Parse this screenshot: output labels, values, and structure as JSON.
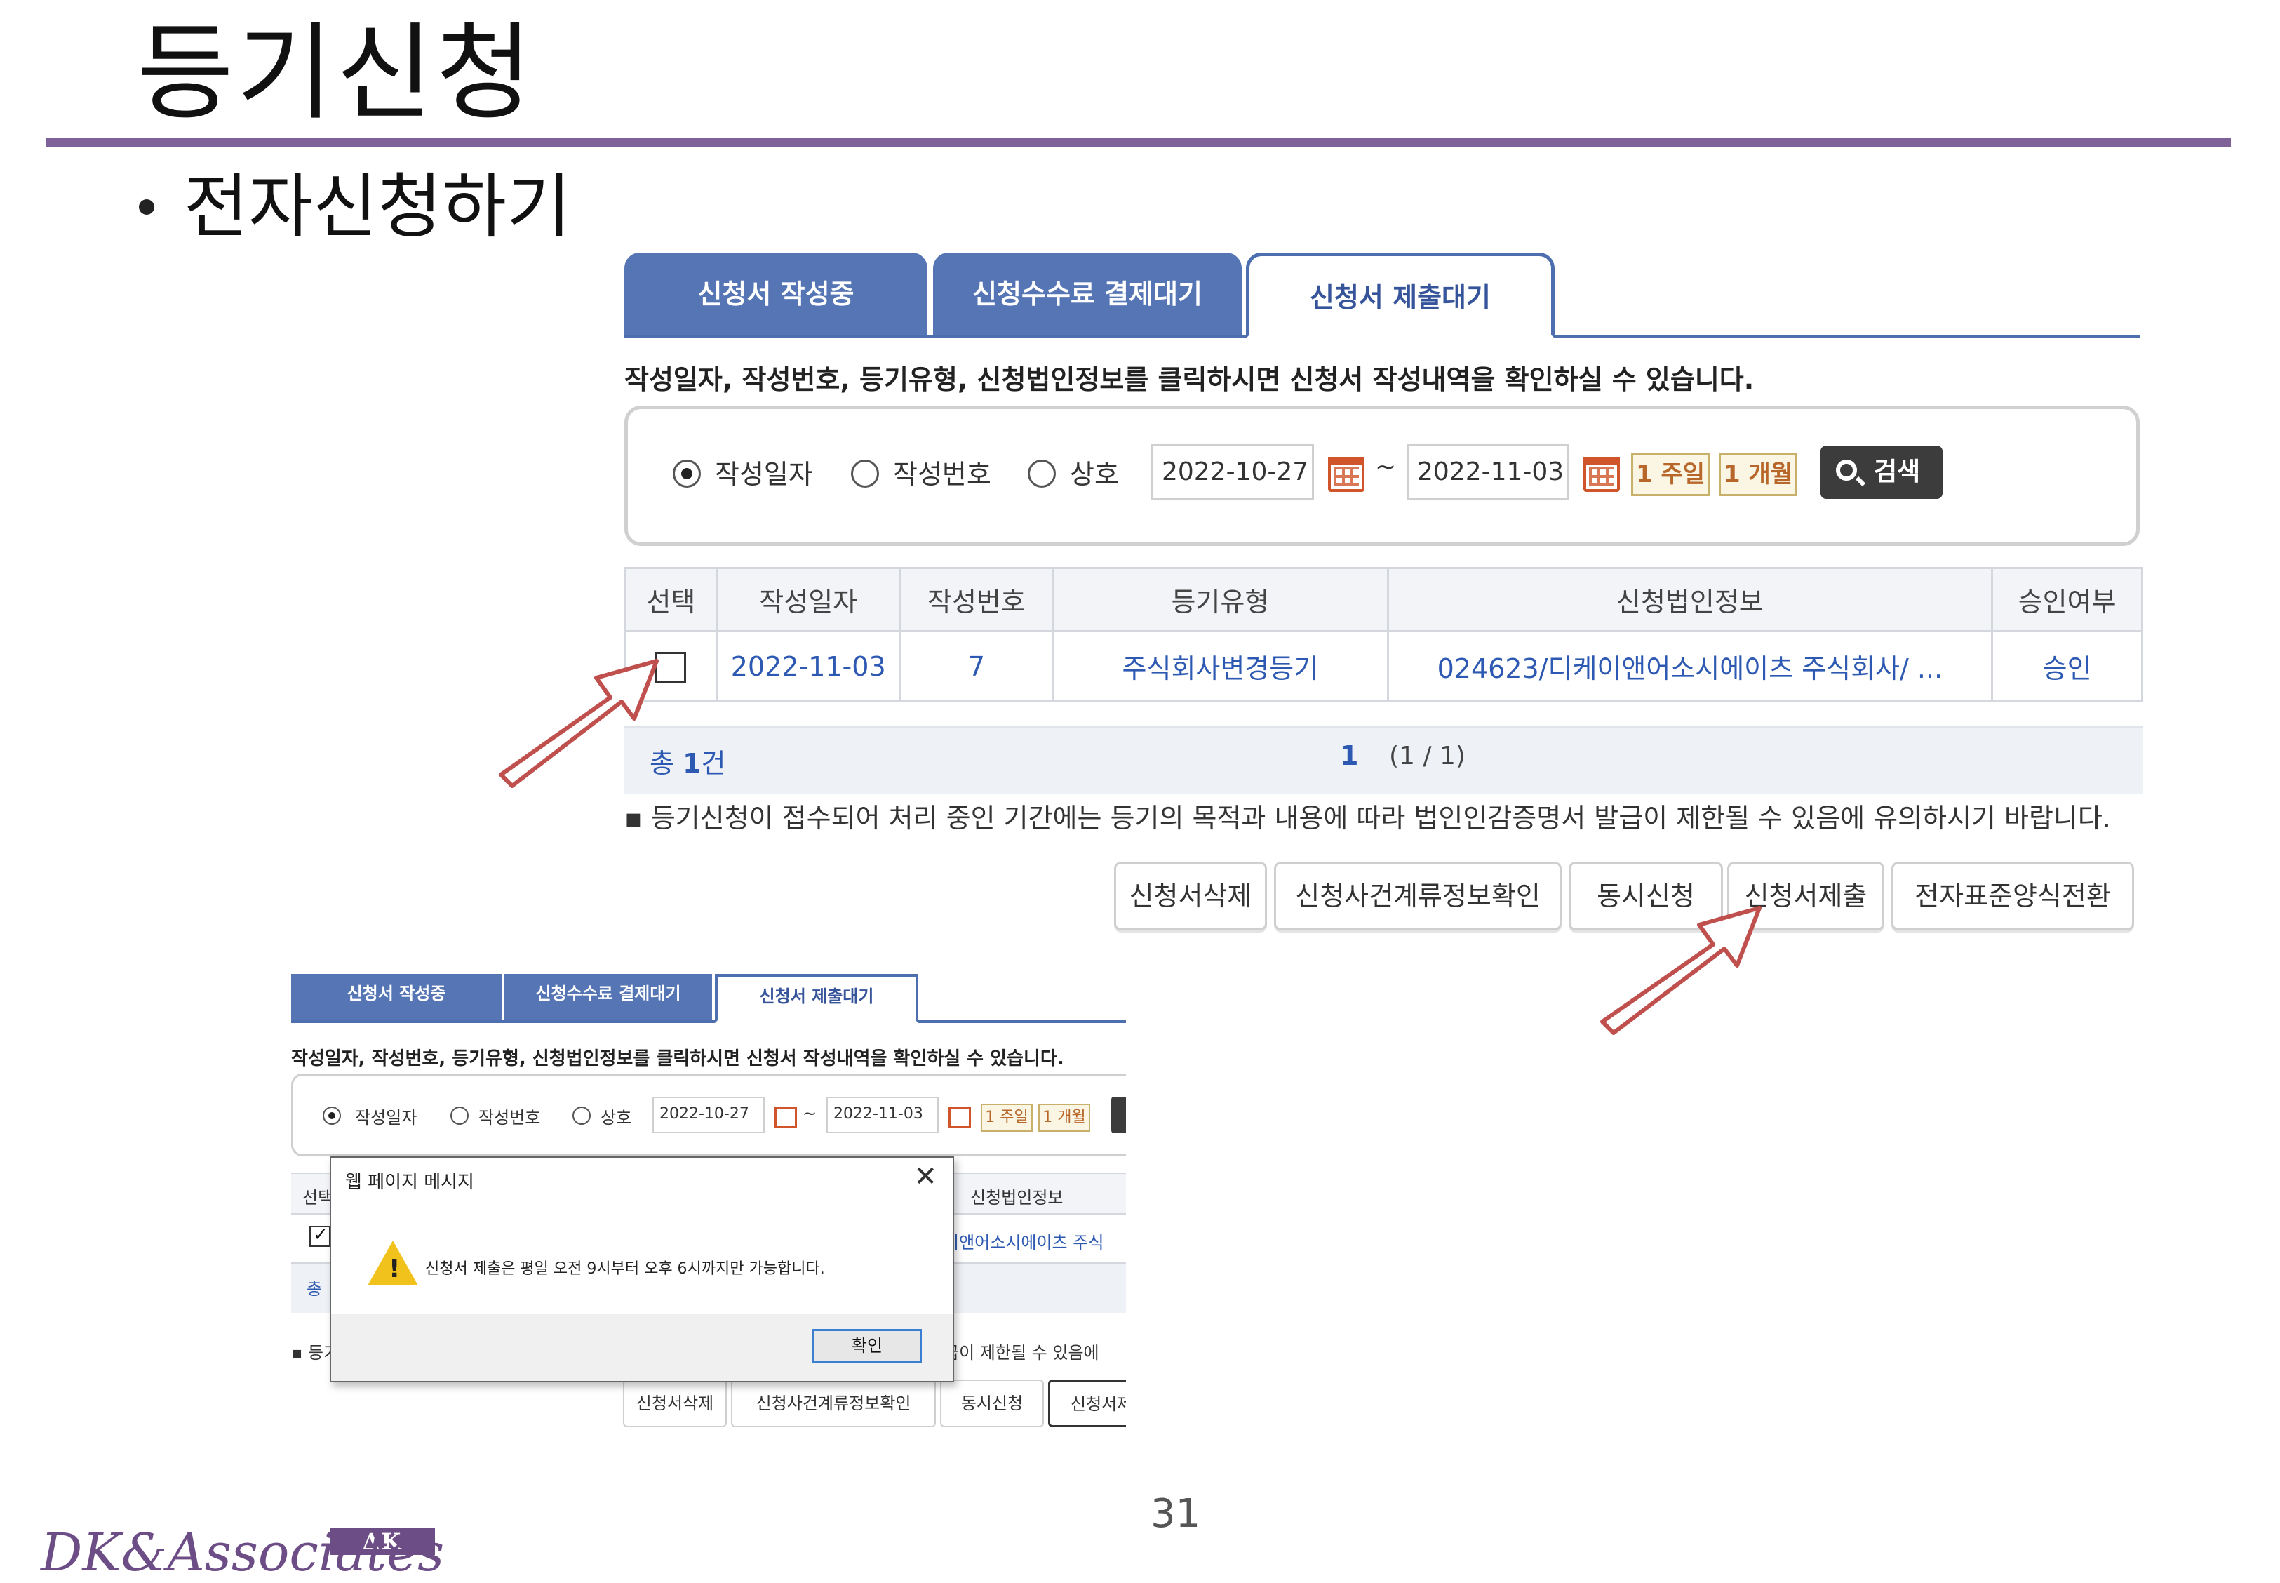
{
  "slide": {
    "title": "등기신청",
    "bullet": "전자신청하기",
    "page_number": "31",
    "logo_text": "DK&Associates",
    "logo_badge": "ΔK"
  },
  "main_screen": {
    "tabs": [
      {
        "label": "신청서 작성중",
        "active": false
      },
      {
        "label": "신청수수료 결제대기",
        "active": false
      },
      {
        "label": "신청서 제출대기",
        "active": true
      }
    ],
    "notice": "작성일자, 작성번호, 등기유형, 신청법인정보를 클릭하시면 신청서 작성내역을 확인하실 수 있습니다.",
    "search": {
      "radios": [
        {
          "label": "작성일자",
          "selected": true
        },
        {
          "label": "작성번호",
          "selected": false
        },
        {
          "label": "상호",
          "selected": false
        }
      ],
      "date_from": "2022-10-27",
      "tilde": "~",
      "date_to": "2022-11-03",
      "period_week": "1 주일",
      "period_month": "1 개월",
      "search_label": "검색"
    },
    "table": {
      "headers": [
        "선택",
        "작성일자",
        "작성번호",
        "등기유형",
        "신청법인정보",
        "승인여부"
      ],
      "rows": [
        {
          "checked": false,
          "date": "2022-11-03",
          "number": "7",
          "type": "주식회사변경등기",
          "company": "024623/디케이앤어소시에이츠 주식회사/ ...",
          "approval": "승인"
        }
      ]
    },
    "pager": {
      "total_prefix": "총",
      "total_count": "1",
      "total_suffix": "건",
      "current_page": "1",
      "page_of": "(1 / 1)"
    },
    "caution": "▪ 등기신청이 접수되어 처리 중인 기간에는 등기의 목적과 내용에 따라 법인인감증명서 발급이 제한될 수 있음에 유의하시기 바랍니다.",
    "buttons": [
      "신청서삭제",
      "신청사건계류정보확인",
      "동시신청",
      "신청서제출",
      "전자표준양식전환"
    ]
  },
  "small_screen": {
    "tabs": [
      "신청서 작성중",
      "신청수수료 결제대기",
      "신청서 제출대기"
    ],
    "notice": "작성일자, 작성번호, 등기유형, 신청법인정보를 클릭하시면 신청서 작성내역을 확인하실 수 있습니다.",
    "radios": [
      "작성일자",
      "작성번호",
      "상호"
    ],
    "date_from": "2022-10-27",
    "date_to": "2022-11-03",
    "period_week": "1 주일",
    "period_month": "1 개월",
    "header_first": "선택",
    "header_company": "신청법인정보",
    "row_company_fragment": "이앤어소시에이츠 주식",
    "pager_fragment": "총",
    "caution_prefix": "▪ 등기",
    "caution_fragment": "급이 제한될 수 있음에",
    "buttons": [
      "신청서삭제",
      "신청사건계류정보확인",
      "동시신청",
      "신청서제·"
    ],
    "dialog": {
      "title": "웹 페이지 메시지",
      "close": "✕",
      "message": "신청서 제출은  평일 오전 9시부터  오후 6시까지만 가능합니다.",
      "ok": "확인",
      "warn_mark": "!"
    }
  },
  "colors": {
    "accent_purple": "#7e6198",
    "tab_blue": "#5575b5",
    "link_blue": "#2d59b2",
    "arrow_red": "#c0504d"
  }
}
